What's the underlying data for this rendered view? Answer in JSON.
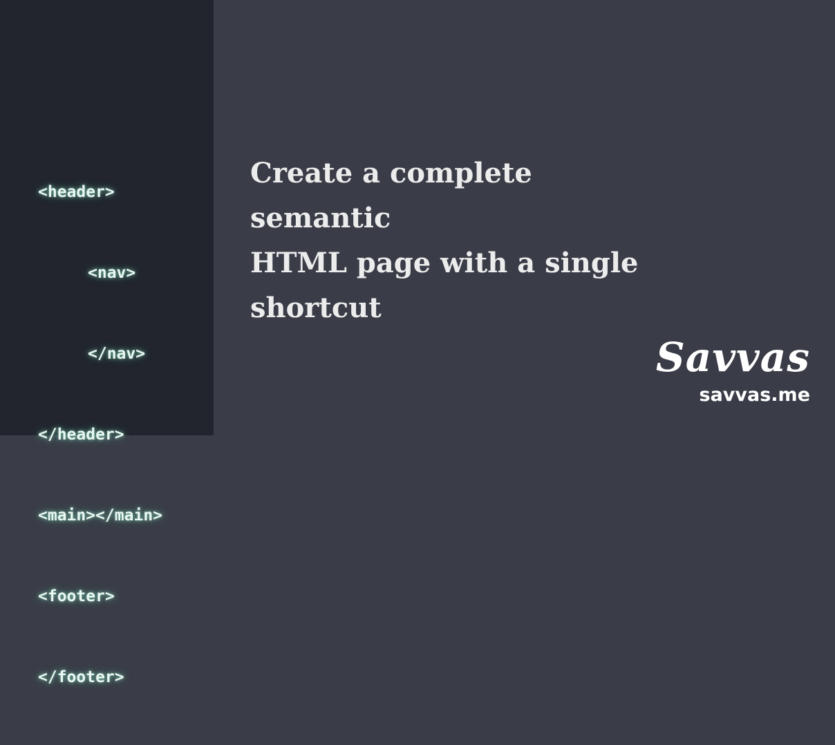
{
  "code": {
    "lines": [
      "<header>",
      "<nav>",
      "</nav>",
      "</header>",
      "<main></main>",
      "<footer>",
      "</footer>"
    ]
  },
  "headline": {
    "line1": "Create a complete semantic",
    "line2": "HTML page with a single",
    "line3": "shortcut"
  },
  "brand": {
    "logo_text": "Savvas",
    "url": "savvas.me"
  }
}
